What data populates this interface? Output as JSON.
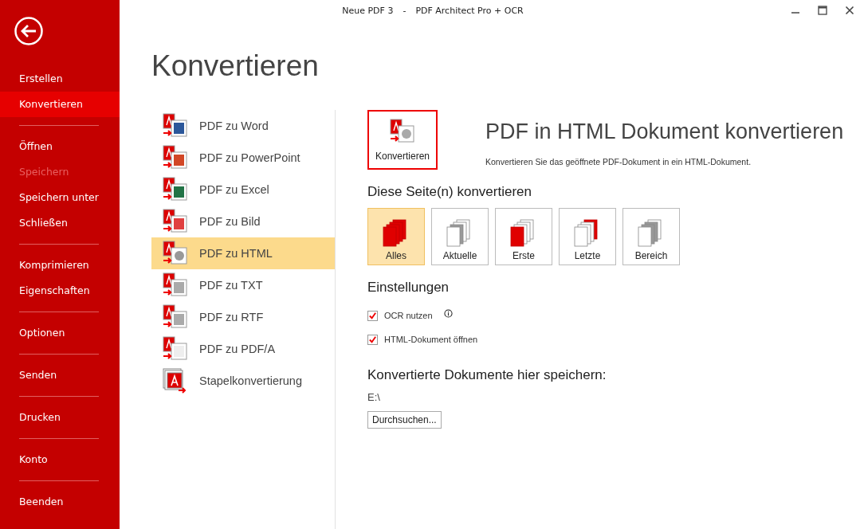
{
  "window": {
    "title_parts": [
      "Neue PDF 3",
      "-",
      "PDF Architect Pro + OCR"
    ]
  },
  "sidebar": {
    "groups": [
      [
        {
          "label": "Erstellen",
          "selected": false,
          "disabled": false
        },
        {
          "label": "Konvertieren",
          "selected": true,
          "disabled": false
        }
      ],
      [
        {
          "label": "Öffnen",
          "selected": false,
          "disabled": false
        },
        {
          "label": "Speichern",
          "selected": false,
          "disabled": true
        },
        {
          "label": "Speichern unter",
          "selected": false,
          "disabled": false
        },
        {
          "label": "Schließen",
          "selected": false,
          "disabled": false
        }
      ],
      [
        {
          "label": "Komprimieren",
          "selected": false,
          "disabled": false
        },
        {
          "label": "Eigenschaften",
          "selected": false,
          "disabled": false
        }
      ],
      [
        {
          "label": "Optionen",
          "selected": false,
          "disabled": false
        }
      ],
      [
        {
          "label": "Senden",
          "selected": false,
          "disabled": false
        }
      ],
      [
        {
          "label": "Drucken",
          "selected": false,
          "disabled": false
        }
      ],
      [
        {
          "label": "Konto",
          "selected": false,
          "disabled": false
        }
      ],
      [
        {
          "label": "Beenden",
          "selected": false,
          "disabled": false
        }
      ]
    ]
  },
  "page_title": "Konvertieren",
  "conversions": [
    {
      "label": "PDF zu Word",
      "kind": "word",
      "selected": false
    },
    {
      "label": "PDF zu PowerPoint",
      "kind": "powerpoint",
      "selected": false
    },
    {
      "label": "PDF zu Excel",
      "kind": "excel",
      "selected": false
    },
    {
      "label": "PDF zu Bild",
      "kind": "image",
      "selected": false
    },
    {
      "label": "PDF zu HTML",
      "kind": "html",
      "selected": true
    },
    {
      "label": "PDF zu TXT",
      "kind": "txt",
      "selected": false
    },
    {
      "label": "PDF zu RTF",
      "kind": "rtf",
      "selected": false
    },
    {
      "label": "PDF zu PDF/A",
      "kind": "pdfa",
      "selected": false
    },
    {
      "label": "Stapelkonvertierung",
      "kind": "batch",
      "selected": false
    }
  ],
  "detail": {
    "button": "Konvertieren",
    "title": "PDF in HTML Dokument konvertieren",
    "description": "Konvertieren Sie das geöffnete PDF-Dokument in ein HTML-Dokument.",
    "pages_heading": "Diese Seite(n) konvertieren",
    "page_options": [
      {
        "label": "Alles",
        "kind": "all",
        "selected": true
      },
      {
        "label": "Aktuelle",
        "kind": "current",
        "selected": false
      },
      {
        "label": "Erste",
        "kind": "first",
        "selected": false
      },
      {
        "label": "Letzte",
        "kind": "last",
        "selected": false
      },
      {
        "label": "Bereich",
        "kind": "range",
        "selected": false
      }
    ],
    "settings_heading": "Einstellungen",
    "settings": [
      {
        "label": "OCR nutzen",
        "checked": true,
        "info": true
      },
      {
        "label": "HTML-Dokument öffnen",
        "checked": true,
        "info": false
      }
    ],
    "save_heading": "Konvertierte Dokumente hier speichern:",
    "path": "E:\\",
    "browse_button": "Durchsuchen..."
  }
}
